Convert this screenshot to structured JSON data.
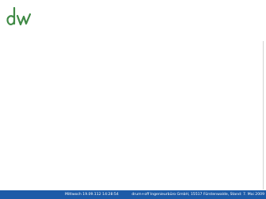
{
  "logo": {
    "icon": "dw-logo-icon",
    "color": "#3f8a45"
  },
  "footer": {
    "date_text": "Mittwoch  19.09.112  14:28:54",
    "company_text": "drum+off Ingenieurbüro GmbH, 15517 Fürstenwalde, Stand: 7. Mai 2009",
    "background": "#1d5ba8"
  }
}
